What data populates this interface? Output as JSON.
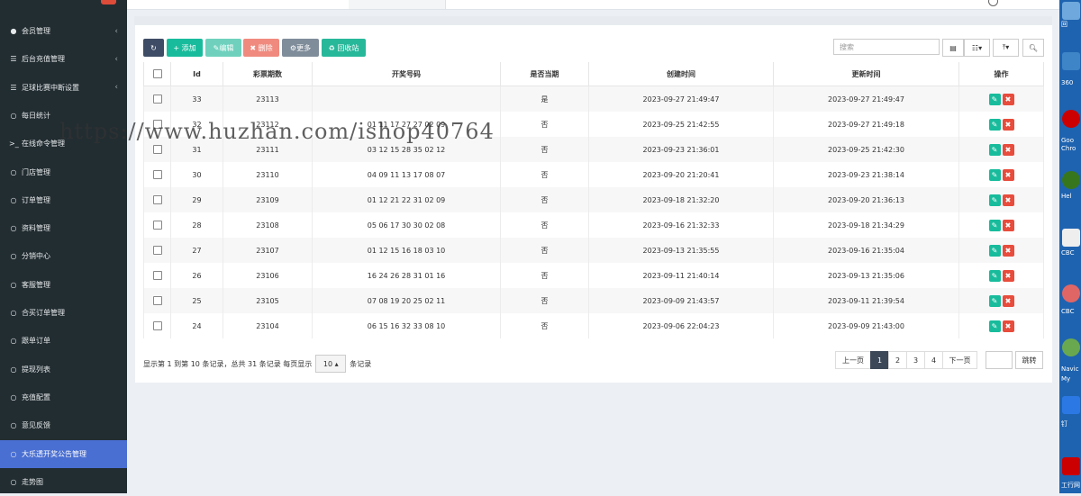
{
  "sidebar": {
    "items": [
      {
        "label": "会员管理",
        "icon": "user-icon",
        "chevron": true
      },
      {
        "label": "后台充值管理",
        "icon": "list-icon",
        "chevron": true
      },
      {
        "label": "足球比赛中断设置",
        "icon": "list-icon",
        "chevron": true
      },
      {
        "label": "每日统计",
        "icon": "circle-icon",
        "chevron": false
      },
      {
        "label": "在线命令管理",
        "icon": "terminal-icon",
        "chevron": false
      },
      {
        "label": "门店管理",
        "icon": "circle-icon",
        "chevron": false
      },
      {
        "label": "订单管理",
        "icon": "circle-icon",
        "chevron": false
      },
      {
        "label": "资料管理",
        "icon": "circle-icon",
        "chevron": false
      },
      {
        "label": "分销中心",
        "icon": "circle-icon",
        "chevron": false
      },
      {
        "label": "客服管理",
        "icon": "circle-icon",
        "chevron": false
      },
      {
        "label": "合买订单管理",
        "icon": "circle-icon",
        "chevron": false
      },
      {
        "label": "跟单订单",
        "icon": "circle-icon",
        "chevron": false
      },
      {
        "label": "提现列表",
        "icon": "circle-icon",
        "chevron": false
      },
      {
        "label": "充值配置",
        "icon": "circle-icon",
        "chevron": false
      },
      {
        "label": "意见反馈",
        "icon": "circle-icon",
        "chevron": false
      },
      {
        "label": "大乐透开奖公告管理",
        "icon": "circle-icon",
        "chevron": false,
        "active": true
      },
      {
        "label": "走势图",
        "icon": "circle-icon",
        "chevron": false
      }
    ]
  },
  "toolbar": {
    "refresh_label": "",
    "add_label": "添加",
    "edit_label": "编辑",
    "delete_label": "删除",
    "more_label": "更多",
    "recycle_label": "回收站",
    "search_placeholder": "搜索"
  },
  "colors": {
    "sidebar_bg": "#222d32",
    "sidebar_active": "#4a6fd2",
    "btn_refresh": "#3f4c66",
    "btn_add": "#18bc9c",
    "btn_edit": "#6fd1bd",
    "btn_delete": "#f08a7e",
    "btn_more": "#7f8c9a",
    "btn_recycle": "#27b89a",
    "page_active": "#3c4858"
  },
  "table": {
    "columns": [
      "Id",
      "彩票期数",
      "开奖号码",
      "是否当期",
      "创建时间",
      "更新时间",
      "操作"
    ],
    "rows": [
      {
        "id": "33",
        "issue": "23113",
        "numbers": "",
        "current": "是",
        "created": "2023-09-27 21:49:47",
        "updated": "2023-09-27 21:49:47"
      },
      {
        "id": "32",
        "issue": "23112",
        "numbers": "01 11 17 27 27 02 09",
        "current": "否",
        "created": "2023-09-25 21:42:55",
        "updated": "2023-09-27 21:49:18"
      },
      {
        "id": "31",
        "issue": "23111",
        "numbers": "03 12 15 28 35 02 12",
        "current": "否",
        "created": "2023-09-23 21:36:01",
        "updated": "2023-09-25 21:42:30"
      },
      {
        "id": "30",
        "issue": "23110",
        "numbers": "04 09 11 13 17 08 07",
        "current": "否",
        "created": "2023-09-20 21:20:41",
        "updated": "2023-09-23 21:38:14"
      },
      {
        "id": "29",
        "issue": "23109",
        "numbers": "01 12 21 22 31 02 09",
        "current": "否",
        "created": "2023-09-18 21:32:20",
        "updated": "2023-09-20 21:36:13"
      },
      {
        "id": "28",
        "issue": "23108",
        "numbers": "05 06 17 30 30 02 08",
        "current": "否",
        "created": "2023-09-16 21:32:33",
        "updated": "2023-09-18 21:34:29"
      },
      {
        "id": "27",
        "issue": "23107",
        "numbers": "01 12 15 16 18 03 10",
        "current": "否",
        "created": "2023-09-13 21:35:55",
        "updated": "2023-09-16 21:35:04"
      },
      {
        "id": "26",
        "issue": "23106",
        "numbers": "16 24 26 28 31 01 16",
        "current": "否",
        "created": "2023-09-11 21:40:14",
        "updated": "2023-09-13 21:35:06"
      },
      {
        "id": "25",
        "issue": "23105",
        "numbers": "07 08 19 20 25 02 11",
        "current": "否",
        "created": "2023-09-09 21:43:57",
        "updated": "2023-09-11 21:39:54"
      },
      {
        "id": "24",
        "issue": "23104",
        "numbers": "06 15 16 32 33 08 10",
        "current": "否",
        "created": "2023-09-06 22:04:23",
        "updated": "2023-09-09 21:43:00"
      }
    ]
  },
  "footer": {
    "summary_prefix": "显示第 1 到第 10 条记录，总共 31 条记录 每页显示",
    "page_size": "10",
    "summary_suffix": "条记录",
    "prev_label": "上一页",
    "pages": [
      "1",
      "2",
      "3",
      "4"
    ],
    "active_page": "1",
    "next_label": "下一页",
    "jump_label": "跳转"
  },
  "watermark": "https://www.huzhan.com/ishop40764",
  "desktop_labels": [
    "回",
    "360",
    "Goo",
    "Chro",
    "Hel",
    "CBC",
    "CBC",
    "Navic",
    "My",
    "钉",
    "工行网"
  ]
}
